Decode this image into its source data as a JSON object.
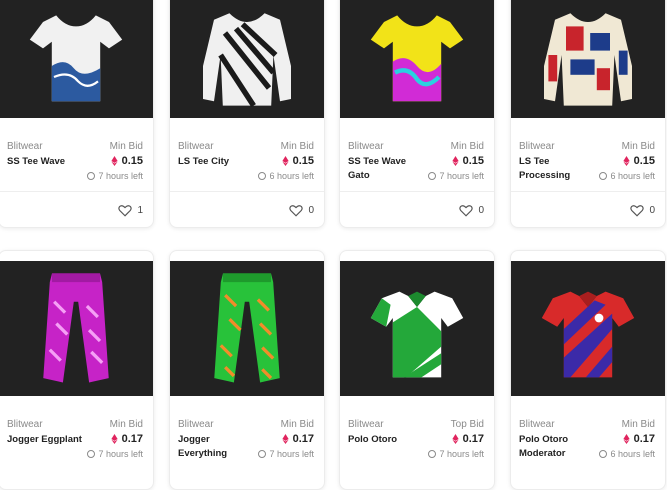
{
  "cards": [
    {
      "brand": "Blitwear",
      "name": "SS Tee Wave",
      "bid_label": "Min Bid",
      "price": "0.15",
      "time_left": "7 hours left",
      "likes": "1",
      "image_icon": "tshirt-icon"
    },
    {
      "brand": "Blitwear",
      "name": "LS Tee City",
      "bid_label": "Min Bid",
      "price": "0.15",
      "time_left": "6 hours left",
      "likes": "0",
      "image_icon": "longsleeve-icon"
    },
    {
      "brand": "Blitwear",
      "name": "SS Tee Wave Gato",
      "bid_label": "Min Bid",
      "price": "0.15",
      "time_left": "7 hours left",
      "likes": "0",
      "image_icon": "tshirt-icon"
    },
    {
      "brand": "Blitwear",
      "name": "LS Tee Processing",
      "bid_label": "Min Bid",
      "price": "0.15",
      "time_left": "6 hours left",
      "likes": "0",
      "image_icon": "longsleeve-icon"
    },
    {
      "brand": "Blitwear",
      "name": "Jogger Eggplant",
      "bid_label": "Min Bid",
      "price": "0.17",
      "time_left": "7 hours left",
      "image_icon": "jogger-icon"
    },
    {
      "brand": "Blitwear",
      "name": "Jogger Everything",
      "bid_label": "Min Bid",
      "price": "0.17",
      "time_left": "7 hours left",
      "image_icon": "jogger-icon"
    },
    {
      "brand": "Blitwear",
      "name": "Polo Otoro",
      "bid_label": "Top Bid",
      "price": "0.17",
      "time_left": "7 hours left",
      "image_icon": "polo-icon"
    },
    {
      "brand": "Blitwear",
      "name": "Polo Otoro Moderator",
      "bid_label": "Min Bid",
      "price": "0.17",
      "time_left": "6 hours left",
      "image_icon": "polo-icon"
    }
  ],
  "colors": {
    "image_bg": "#222222",
    "eth_accent": "#e0245e",
    "text_primary": "#222222",
    "text_muted": "#8a8a8a"
  }
}
